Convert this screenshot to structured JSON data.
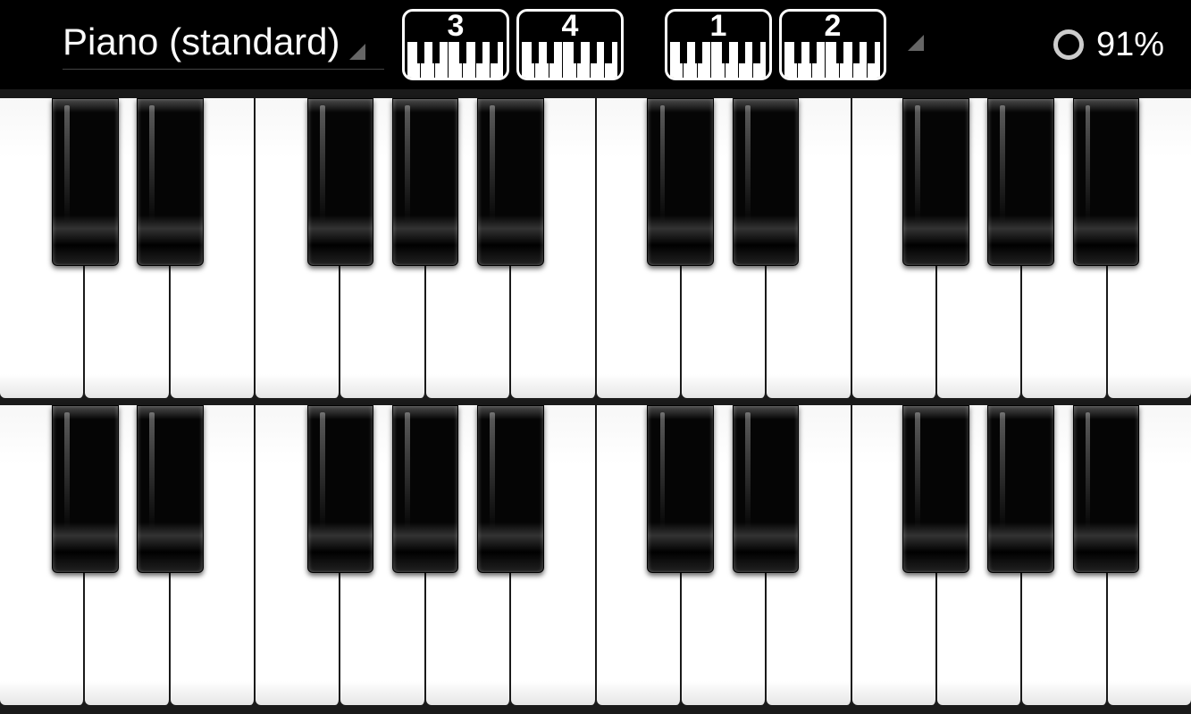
{
  "header": {
    "instrument_label": "Piano (standard)",
    "percent_label": "91%"
  },
  "octave_buttons": {
    "top_row": [
      "3",
      "4"
    ],
    "bottom_row": [
      "1",
      "2"
    ]
  },
  "keyboard": {
    "rows": 2,
    "white_keys_per_row": 14,
    "black_key_positions_pct": [
      4.35,
      11.5,
      25.78,
      32.92,
      40.07,
      54.35,
      61.5,
      75.78,
      82.92,
      90.07
    ]
  },
  "mini_keyboard": {
    "white_keys": 7,
    "black_left_pct": [
      10,
      26,
      54,
      70,
      86
    ]
  }
}
